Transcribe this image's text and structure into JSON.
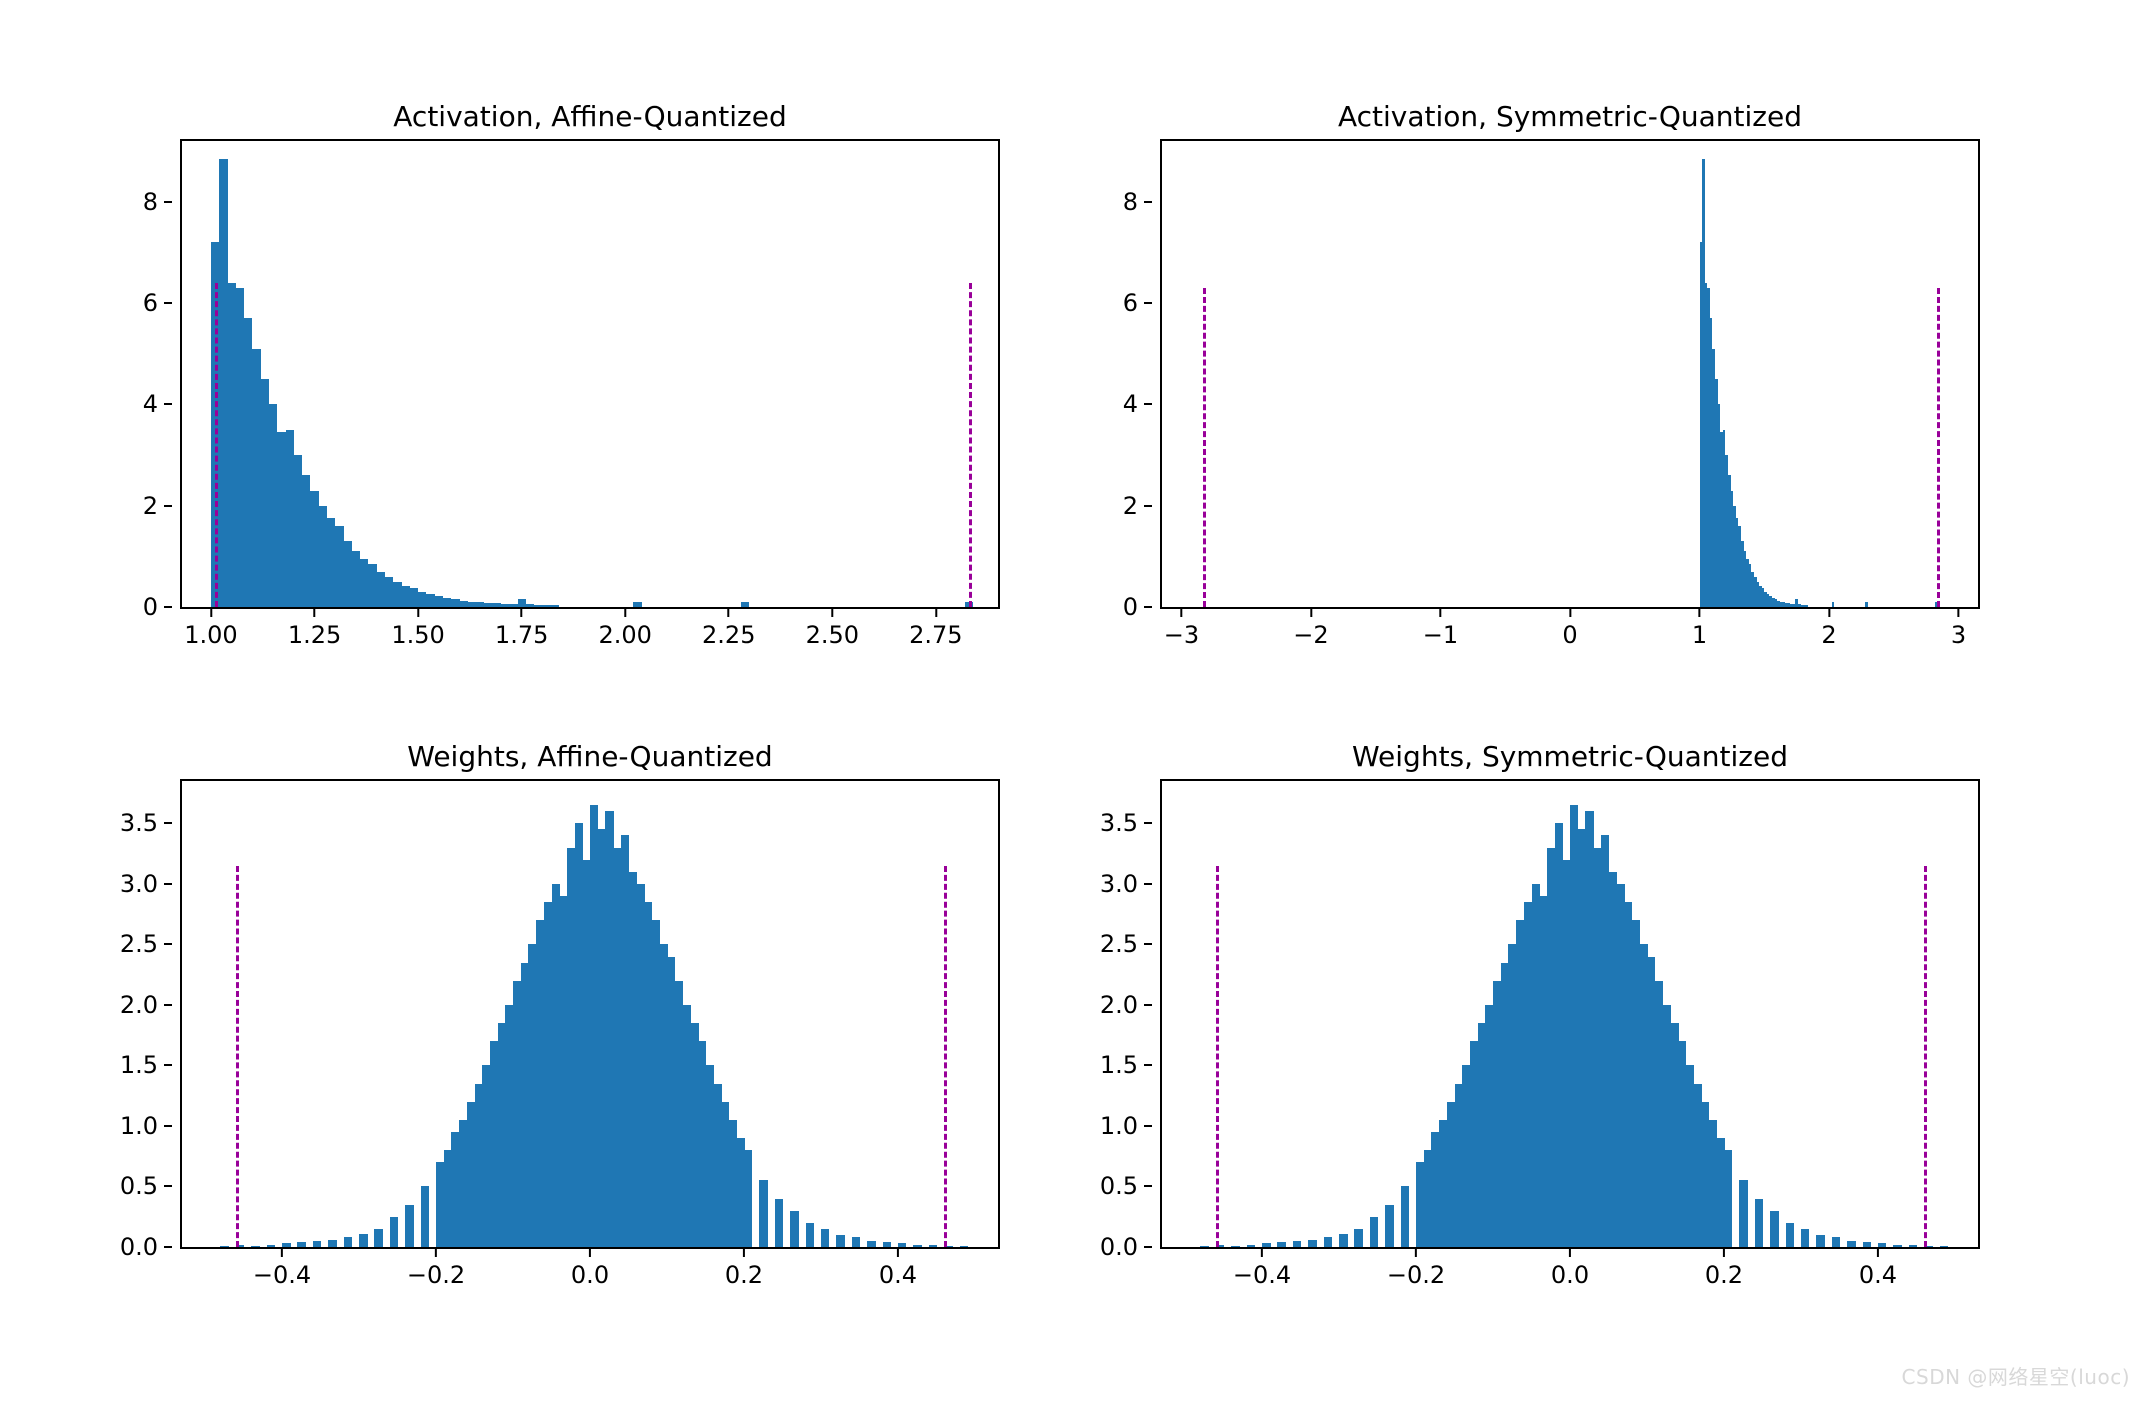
{
  "watermark": "CSDN @网络星空(luoc)",
  "chart_data": [
    {
      "id": "act-affine",
      "title": "Activation, Affine-Quantized",
      "type": "bar",
      "xlabel": "",
      "ylabel": "",
      "xlim": [
        0.93,
        2.9
      ],
      "ylim": [
        0,
        9.2
      ],
      "xticks": [
        1.0,
        1.25,
        1.5,
        1.75,
        2.0,
        2.25,
        2.5,
        2.75
      ],
      "yticks": [
        0,
        2,
        4,
        6,
        8
      ],
      "xtick_fmt": 2,
      "vlines": [
        {
          "x": 1.01,
          "y": 6.4
        },
        {
          "x": 2.83,
          "y": 6.4
        }
      ],
      "bins": [
        {
          "x": 1.0,
          "h": 7.2
        },
        {
          "x": 1.02,
          "h": 8.85
        },
        {
          "x": 1.04,
          "h": 6.4
        },
        {
          "x": 1.06,
          "h": 6.3
        },
        {
          "x": 1.08,
          "h": 5.7
        },
        {
          "x": 1.1,
          "h": 5.1
        },
        {
          "x": 1.12,
          "h": 4.5
        },
        {
          "x": 1.14,
          "h": 4.0
        },
        {
          "x": 1.16,
          "h": 3.45
        },
        {
          "x": 1.18,
          "h": 3.5
        },
        {
          "x": 1.2,
          "h": 3.0
        },
        {
          "x": 1.22,
          "h": 2.6
        },
        {
          "x": 1.24,
          "h": 2.3
        },
        {
          "x": 1.26,
          "h": 2.0
        },
        {
          "x": 1.28,
          "h": 1.75
        },
        {
          "x": 1.3,
          "h": 1.6
        },
        {
          "x": 1.32,
          "h": 1.3
        },
        {
          "x": 1.34,
          "h": 1.1
        },
        {
          "x": 1.36,
          "h": 0.95
        },
        {
          "x": 1.38,
          "h": 0.85
        },
        {
          "x": 1.4,
          "h": 0.7
        },
        {
          "x": 1.42,
          "h": 0.6
        },
        {
          "x": 1.44,
          "h": 0.5
        },
        {
          "x": 1.46,
          "h": 0.42
        },
        {
          "x": 1.48,
          "h": 0.38
        },
        {
          "x": 1.5,
          "h": 0.3
        },
        {
          "x": 1.52,
          "h": 0.25
        },
        {
          "x": 1.54,
          "h": 0.22
        },
        {
          "x": 1.56,
          "h": 0.18
        },
        {
          "x": 1.58,
          "h": 0.15
        },
        {
          "x": 1.6,
          "h": 0.12
        },
        {
          "x": 1.62,
          "h": 0.1
        },
        {
          "x": 1.64,
          "h": 0.09
        },
        {
          "x": 1.66,
          "h": 0.08
        },
        {
          "x": 1.68,
          "h": 0.07
        },
        {
          "x": 1.7,
          "h": 0.06
        },
        {
          "x": 1.72,
          "h": 0.05
        },
        {
          "x": 1.74,
          "h": 0.15
        },
        {
          "x": 1.76,
          "h": 0.05
        },
        {
          "x": 1.78,
          "h": 0.04
        },
        {
          "x": 1.8,
          "h": 0.03
        },
        {
          "x": 1.82,
          "h": 0.03
        },
        {
          "x": 2.02,
          "h": 0.1
        },
        {
          "x": 2.28,
          "h": 0.09
        },
        {
          "x": 2.82,
          "h": 0.1
        }
      ],
      "bin_width": 0.02
    },
    {
      "id": "act-sym",
      "title": "Activation, Symmetric-Quantized",
      "type": "bar",
      "xlabel": "",
      "ylabel": "",
      "xlim": [
        -3.15,
        3.15
      ],
      "ylim": [
        0,
        9.2
      ],
      "xticks": [
        -3,
        -2,
        -1,
        0,
        1,
        2,
        3
      ],
      "yticks": [
        0,
        2,
        4,
        6,
        8
      ],
      "xtick_fmt": 0,
      "vlines": [
        {
          "x": -2.83,
          "y": 6.3
        },
        {
          "x": 2.83,
          "y": 6.3
        }
      ],
      "bins": [
        {
          "x": 1.0,
          "h": 7.2
        },
        {
          "x": 1.02,
          "h": 8.85
        },
        {
          "x": 1.04,
          "h": 6.4
        },
        {
          "x": 1.06,
          "h": 6.3
        },
        {
          "x": 1.08,
          "h": 5.7
        },
        {
          "x": 1.1,
          "h": 5.1
        },
        {
          "x": 1.12,
          "h": 4.5
        },
        {
          "x": 1.14,
          "h": 4.0
        },
        {
          "x": 1.16,
          "h": 3.45
        },
        {
          "x": 1.18,
          "h": 3.5
        },
        {
          "x": 1.2,
          "h": 3.0
        },
        {
          "x": 1.22,
          "h": 2.6
        },
        {
          "x": 1.24,
          "h": 2.3
        },
        {
          "x": 1.26,
          "h": 2.0
        },
        {
          "x": 1.28,
          "h": 1.75
        },
        {
          "x": 1.3,
          "h": 1.6
        },
        {
          "x": 1.32,
          "h": 1.3
        },
        {
          "x": 1.34,
          "h": 1.1
        },
        {
          "x": 1.36,
          "h": 0.95
        },
        {
          "x": 1.38,
          "h": 0.85
        },
        {
          "x": 1.4,
          "h": 0.7
        },
        {
          "x": 1.42,
          "h": 0.6
        },
        {
          "x": 1.44,
          "h": 0.5
        },
        {
          "x": 1.46,
          "h": 0.42
        },
        {
          "x": 1.48,
          "h": 0.38
        },
        {
          "x": 1.5,
          "h": 0.3
        },
        {
          "x": 1.52,
          "h": 0.25
        },
        {
          "x": 1.54,
          "h": 0.22
        },
        {
          "x": 1.56,
          "h": 0.18
        },
        {
          "x": 1.58,
          "h": 0.15
        },
        {
          "x": 1.6,
          "h": 0.12
        },
        {
          "x": 1.62,
          "h": 0.1
        },
        {
          "x": 1.64,
          "h": 0.09
        },
        {
          "x": 1.66,
          "h": 0.08
        },
        {
          "x": 1.68,
          "h": 0.07
        },
        {
          "x": 1.7,
          "h": 0.06
        },
        {
          "x": 1.72,
          "h": 0.05
        },
        {
          "x": 1.74,
          "h": 0.15
        },
        {
          "x": 1.76,
          "h": 0.05
        },
        {
          "x": 1.78,
          "h": 0.04
        },
        {
          "x": 1.8,
          "h": 0.03
        },
        {
          "x": 1.82,
          "h": 0.03
        },
        {
          "x": 2.02,
          "h": 0.1
        },
        {
          "x": 2.28,
          "h": 0.09
        },
        {
          "x": 2.82,
          "h": 0.1
        }
      ],
      "bin_width": 0.02
    },
    {
      "id": "w-affine",
      "title": "Weights, Affine-Quantized",
      "type": "bar",
      "xlabel": "",
      "ylabel": "",
      "xlim": [
        -0.53,
        0.53
      ],
      "ylim": [
        0,
        3.85
      ],
      "xticks": [
        -0.4,
        -0.2,
        0.0,
        0.2,
        0.4
      ],
      "yticks": [
        0.0,
        0.5,
        1.0,
        1.5,
        2.0,
        2.5,
        3.0,
        3.5
      ],
      "xtick_fmt": 1,
      "vlines": [
        {
          "x": -0.46,
          "y": 3.15
        },
        {
          "x": 0.46,
          "y": 3.15
        }
      ],
      "bins": [
        {
          "x": -0.48,
          "h": 0.01
        },
        {
          "x": -0.46,
          "h": 0.02
        },
        {
          "x": -0.44,
          "h": 0.01
        },
        {
          "x": -0.42,
          "h": 0.02
        },
        {
          "x": -0.4,
          "h": 0.03
        },
        {
          "x": -0.38,
          "h": 0.04
        },
        {
          "x": -0.36,
          "h": 0.05
        },
        {
          "x": -0.34,
          "h": 0.06
        },
        {
          "x": -0.32,
          "h": 0.08
        },
        {
          "x": -0.3,
          "h": 0.11
        },
        {
          "x": -0.28,
          "h": 0.15
        },
        {
          "x": -0.26,
          "h": 0.25
        },
        {
          "x": -0.24,
          "h": 0.35
        },
        {
          "x": -0.22,
          "h": 0.5
        },
        {
          "x": -0.2,
          "h": 0.7
        },
        {
          "x": -0.19,
          "h": 0.8
        },
        {
          "x": -0.18,
          "h": 0.95
        },
        {
          "x": -0.17,
          "h": 1.05
        },
        {
          "x": -0.16,
          "h": 1.2
        },
        {
          "x": -0.15,
          "h": 1.35
        },
        {
          "x": -0.14,
          "h": 1.5
        },
        {
          "x": -0.13,
          "h": 1.7
        },
        {
          "x": -0.12,
          "h": 1.85
        },
        {
          "x": -0.11,
          "h": 2.0
        },
        {
          "x": -0.1,
          "h": 2.2
        },
        {
          "x": -0.09,
          "h": 2.35
        },
        {
          "x": -0.08,
          "h": 2.5
        },
        {
          "x": -0.07,
          "h": 2.7
        },
        {
          "x": -0.06,
          "h": 2.85
        },
        {
          "x": -0.05,
          "h": 3.0
        },
        {
          "x": -0.04,
          "h": 2.9
        },
        {
          "x": -0.03,
          "h": 3.3
        },
        {
          "x": -0.02,
          "h": 3.5
        },
        {
          "x": -0.01,
          "h": 3.2
        },
        {
          "x": 0.0,
          "h": 3.65
        },
        {
          "x": 0.01,
          "h": 3.45
        },
        {
          "x": 0.02,
          "h": 3.6
        },
        {
          "x": 0.03,
          "h": 3.3
        },
        {
          "x": 0.04,
          "h": 3.4
        },
        {
          "x": 0.05,
          "h": 3.1
        },
        {
          "x": 0.06,
          "h": 3.0
        },
        {
          "x": 0.07,
          "h": 2.85
        },
        {
          "x": 0.08,
          "h": 2.7
        },
        {
          "x": 0.09,
          "h": 2.5
        },
        {
          "x": 0.1,
          "h": 2.4
        },
        {
          "x": 0.11,
          "h": 2.2
        },
        {
          "x": 0.12,
          "h": 2.0
        },
        {
          "x": 0.13,
          "h": 1.85
        },
        {
          "x": 0.14,
          "h": 1.7
        },
        {
          "x": 0.15,
          "h": 1.5
        },
        {
          "x": 0.16,
          "h": 1.35
        },
        {
          "x": 0.17,
          "h": 1.2
        },
        {
          "x": 0.18,
          "h": 1.05
        },
        {
          "x": 0.19,
          "h": 0.9
        },
        {
          "x": 0.2,
          "h": 0.8
        },
        {
          "x": 0.22,
          "h": 0.55
        },
        {
          "x": 0.24,
          "h": 0.4
        },
        {
          "x": 0.26,
          "h": 0.3
        },
        {
          "x": 0.28,
          "h": 0.2
        },
        {
          "x": 0.3,
          "h": 0.15
        },
        {
          "x": 0.32,
          "h": 0.1
        },
        {
          "x": 0.34,
          "h": 0.08
        },
        {
          "x": 0.36,
          "h": 0.05
        },
        {
          "x": 0.38,
          "h": 0.04
        },
        {
          "x": 0.4,
          "h": 0.03
        },
        {
          "x": 0.42,
          "h": 0.02
        },
        {
          "x": 0.44,
          "h": 0.02
        },
        {
          "x": 0.46,
          "h": 0.01
        },
        {
          "x": 0.48,
          "h": 0.01
        }
      ],
      "bin_width": 0.011
    },
    {
      "id": "w-sym",
      "title": "Weights, Symmetric-Quantized",
      "type": "bar",
      "xlabel": "",
      "ylabel": "",
      "xlim": [
        -0.53,
        0.53
      ],
      "ylim": [
        0,
        3.85
      ],
      "xticks": [
        -0.4,
        -0.2,
        0.0,
        0.2,
        0.4
      ],
      "yticks": [
        0.0,
        0.5,
        1.0,
        1.5,
        2.0,
        2.5,
        3.0,
        3.5
      ],
      "xtick_fmt": 1,
      "vlines": [
        {
          "x": -0.46,
          "y": 3.15
        },
        {
          "x": 0.46,
          "y": 3.15
        }
      ],
      "bins": [
        {
          "x": -0.48,
          "h": 0.01
        },
        {
          "x": -0.46,
          "h": 0.02
        },
        {
          "x": -0.44,
          "h": 0.01
        },
        {
          "x": -0.42,
          "h": 0.02
        },
        {
          "x": -0.4,
          "h": 0.03
        },
        {
          "x": -0.38,
          "h": 0.04
        },
        {
          "x": -0.36,
          "h": 0.05
        },
        {
          "x": -0.34,
          "h": 0.06
        },
        {
          "x": -0.32,
          "h": 0.08
        },
        {
          "x": -0.3,
          "h": 0.11
        },
        {
          "x": -0.28,
          "h": 0.15
        },
        {
          "x": -0.26,
          "h": 0.25
        },
        {
          "x": -0.24,
          "h": 0.35
        },
        {
          "x": -0.22,
          "h": 0.5
        },
        {
          "x": -0.2,
          "h": 0.7
        },
        {
          "x": -0.19,
          "h": 0.8
        },
        {
          "x": -0.18,
          "h": 0.95
        },
        {
          "x": -0.17,
          "h": 1.05
        },
        {
          "x": -0.16,
          "h": 1.2
        },
        {
          "x": -0.15,
          "h": 1.35
        },
        {
          "x": -0.14,
          "h": 1.5
        },
        {
          "x": -0.13,
          "h": 1.7
        },
        {
          "x": -0.12,
          "h": 1.85
        },
        {
          "x": -0.11,
          "h": 2.0
        },
        {
          "x": -0.1,
          "h": 2.2
        },
        {
          "x": -0.09,
          "h": 2.35
        },
        {
          "x": -0.08,
          "h": 2.5
        },
        {
          "x": -0.07,
          "h": 2.7
        },
        {
          "x": -0.06,
          "h": 2.85
        },
        {
          "x": -0.05,
          "h": 3.0
        },
        {
          "x": -0.04,
          "h": 2.9
        },
        {
          "x": -0.03,
          "h": 3.3
        },
        {
          "x": -0.02,
          "h": 3.5
        },
        {
          "x": -0.01,
          "h": 3.2
        },
        {
          "x": 0.0,
          "h": 3.65
        },
        {
          "x": 0.01,
          "h": 3.45
        },
        {
          "x": 0.02,
          "h": 3.6
        },
        {
          "x": 0.03,
          "h": 3.3
        },
        {
          "x": 0.04,
          "h": 3.4
        },
        {
          "x": 0.05,
          "h": 3.1
        },
        {
          "x": 0.06,
          "h": 3.0
        },
        {
          "x": 0.07,
          "h": 2.85
        },
        {
          "x": 0.08,
          "h": 2.7
        },
        {
          "x": 0.09,
          "h": 2.5
        },
        {
          "x": 0.1,
          "h": 2.4
        },
        {
          "x": 0.11,
          "h": 2.2
        },
        {
          "x": 0.12,
          "h": 2.0
        },
        {
          "x": 0.13,
          "h": 1.85
        },
        {
          "x": 0.14,
          "h": 1.7
        },
        {
          "x": 0.15,
          "h": 1.5
        },
        {
          "x": 0.16,
          "h": 1.35
        },
        {
          "x": 0.17,
          "h": 1.2
        },
        {
          "x": 0.18,
          "h": 1.05
        },
        {
          "x": 0.19,
          "h": 0.9
        },
        {
          "x": 0.2,
          "h": 0.8
        },
        {
          "x": 0.22,
          "h": 0.55
        },
        {
          "x": 0.24,
          "h": 0.4
        },
        {
          "x": 0.26,
          "h": 0.3
        },
        {
          "x": 0.28,
          "h": 0.2
        },
        {
          "x": 0.3,
          "h": 0.15
        },
        {
          "x": 0.32,
          "h": 0.1
        },
        {
          "x": 0.34,
          "h": 0.08
        },
        {
          "x": 0.36,
          "h": 0.05
        },
        {
          "x": 0.38,
          "h": 0.04
        },
        {
          "x": 0.4,
          "h": 0.03
        },
        {
          "x": 0.42,
          "h": 0.02
        },
        {
          "x": 0.44,
          "h": 0.02
        },
        {
          "x": 0.46,
          "h": 0.01
        },
        {
          "x": 0.48,
          "h": 0.01
        }
      ],
      "bin_width": 0.011
    }
  ]
}
